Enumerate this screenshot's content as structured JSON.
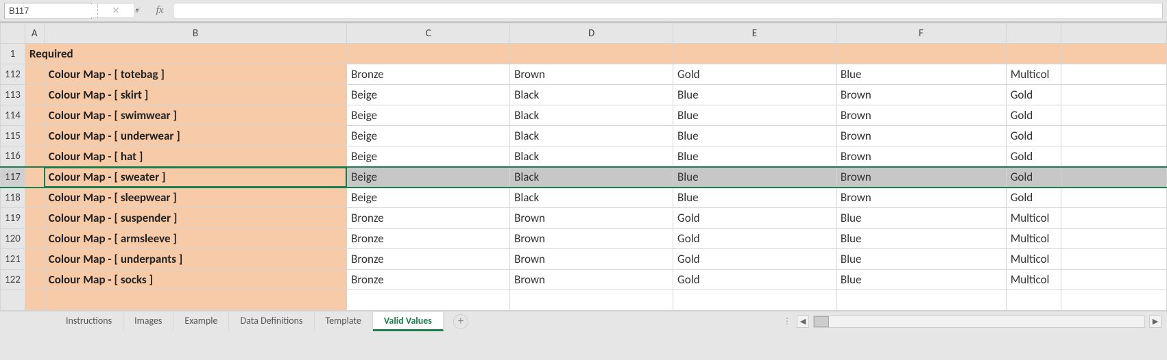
{
  "name_box": {
    "value": "B117"
  },
  "fx_label": "fx",
  "formula": "",
  "columns": [
    "A",
    "B",
    "C",
    "D",
    "E",
    "F"
  ],
  "header_row": {
    "num": "1",
    "b": "Required"
  },
  "rows": [
    {
      "num": "112",
      "b": "Colour Map - [ totebag ]",
      "c": "Bronze",
      "d": "Brown",
      "e": "Gold",
      "f": "Blue",
      "g": "Multicol"
    },
    {
      "num": "113",
      "b": "Colour Map - [ skirt ]",
      "c": "Beige",
      "d": "Black",
      "e": "Blue",
      "f": "Brown",
      "g": "Gold"
    },
    {
      "num": "114",
      "b": "Colour Map - [ swimwear ]",
      "c": "Beige",
      "d": "Black",
      "e": "Blue",
      "f": "Brown",
      "g": "Gold"
    },
    {
      "num": "115",
      "b": "Colour Map - [ underwear ]",
      "c": "Beige",
      "d": "Black",
      "e": "Blue",
      "f": "Brown",
      "g": "Gold"
    },
    {
      "num": "116",
      "b": "Colour Map - [ hat ]",
      "c": "Beige",
      "d": "Black",
      "e": "Blue",
      "f": "Brown",
      "g": "Gold"
    },
    {
      "num": "117",
      "b": "Colour Map - [ sweater ]",
      "c": "Beige",
      "d": "Black",
      "e": "Blue",
      "f": "Brown",
      "g": "Gold",
      "selected": true
    },
    {
      "num": "118",
      "b": "Colour Map - [ sleepwear ]",
      "c": "Beige",
      "d": "Black",
      "e": "Blue",
      "f": "Brown",
      "g": "Gold"
    },
    {
      "num": "119",
      "b": "Colour Map - [ suspender ]",
      "c": "Bronze",
      "d": "Brown",
      "e": "Gold",
      "f": "Blue",
      "g": "Multicol"
    },
    {
      "num": "120",
      "b": "Colour Map - [ armsleeve ]",
      "c": "Bronze",
      "d": "Brown",
      "e": "Gold",
      "f": "Blue",
      "g": "Multicol"
    },
    {
      "num": "121",
      "b": "Colour Map - [ underpants ]",
      "c": "Bronze",
      "d": "Brown",
      "e": "Gold",
      "f": "Blue",
      "g": "Multicol"
    },
    {
      "num": "122",
      "b": "Colour Map - [ socks ]",
      "c": "Bronze",
      "d": "Brown",
      "e": "Gold",
      "f": "Blue",
      "g": "Multicol"
    }
  ],
  "tabs": [
    {
      "label": "Instructions"
    },
    {
      "label": "Images"
    },
    {
      "label": "Example"
    },
    {
      "label": "Data Definitions"
    },
    {
      "label": "Template"
    },
    {
      "label": "Valid Values",
      "active": true
    }
  ],
  "icons": {
    "cancel": "✕",
    "accept": "✓",
    "plus": "+"
  }
}
